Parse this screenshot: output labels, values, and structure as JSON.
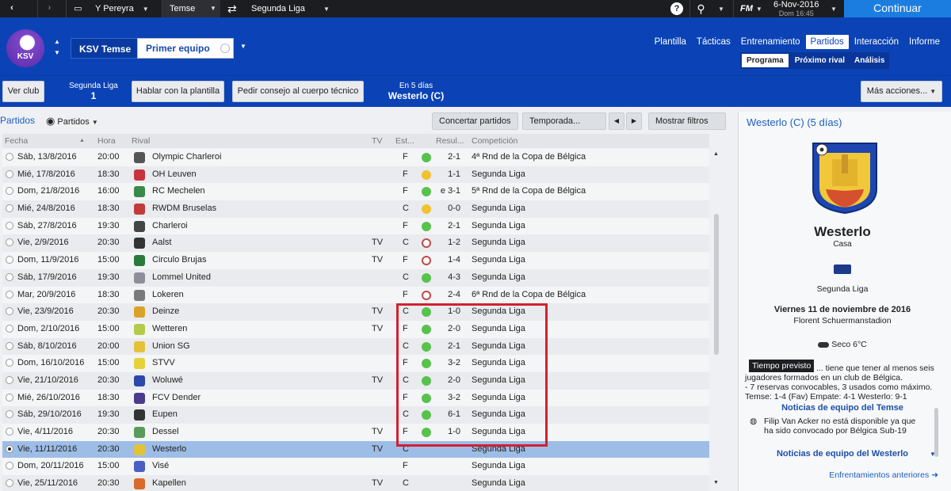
{
  "topbar": {
    "manager": "Y Pereyra",
    "club_tab": "Temse",
    "league": "Segunda Liga",
    "logo": "FM",
    "date": "6-Nov-2016",
    "day_time": "Dom 16:45",
    "continue": "Continuar",
    "icons": [
      "back-arrow",
      "forward-arrow",
      "bus-icon",
      "transfer-arrows-icon",
      "help-icon",
      "search-icon",
      "fm-logo"
    ]
  },
  "header": {
    "club_logo": "KSV",
    "team_name": "KSV Temse",
    "team_selector": "Primer equipo",
    "nav": [
      "Plantilla",
      "Tácticas",
      "Entrenamiento",
      "Partidos",
      "Interacción",
      "Informe"
    ],
    "nav_active": "Partidos",
    "subnav": [
      "Programa",
      "Próximo rival",
      "Análisis"
    ],
    "subnav_active": "Programa"
  },
  "actionbar": {
    "view_club": "Ver club",
    "league_label": "Segunda Liga",
    "league_pos": "1",
    "talk_squad": "Hablar con la plantilla",
    "ask_staff": "Pedir consejo al cuerpo técnico",
    "next_in": "En 5 días",
    "next_opp": "Westerlo (C)",
    "more_actions": "Más acciones..."
  },
  "listbar": {
    "crumb": "Partidos",
    "view": "Partidos",
    "arrange": "Concertar partidos",
    "season": "Temporada...",
    "filters": "Mostrar filtros"
  },
  "columns": {
    "date": "Fecha",
    "time": "Hora",
    "rival": "Rival",
    "tv": "TV",
    "status": "Est...",
    "result": "Resul...",
    "competition": "Competición"
  },
  "colors": {
    "win": "#57c24c",
    "draw": "#f1c130",
    "loss": "#c04a4a",
    "accent": "#0b43b6",
    "highlight": "#d42030"
  },
  "matches": [
    {
      "date": "Sáb, 13/8/2016",
      "time": "20:00",
      "rival": "Olympic Charleroi",
      "tv": "",
      "venue": "F",
      "outcome": "win",
      "result": "2-1",
      "competition": "4ª Rnd de la Copa de Bélgica",
      "crest": "#555555"
    },
    {
      "date": "Mié, 17/8/2016",
      "time": "18:30",
      "rival": "OH Leuven",
      "tv": "",
      "venue": "F",
      "outcome": "draw",
      "result": "1-1",
      "competition": "Segunda Liga",
      "crest": "#c7343c"
    },
    {
      "date": "Dom, 21/8/2016",
      "time": "16:00",
      "rival": "RC Mechelen",
      "tv": "",
      "venue": "F",
      "outcome": "win",
      "result": "e 3-1",
      "competition": "5ª Rnd de la Copa de Bélgica",
      "crest": "#3a8a4a"
    },
    {
      "date": "Mié, 24/8/2016",
      "time": "18:30",
      "rival": "RWDM Bruselas",
      "tv": "",
      "venue": "C",
      "outcome": "draw",
      "result": "0-0",
      "competition": "Segunda Liga",
      "crest": "#c23a3a"
    },
    {
      "date": "Sáb, 27/8/2016",
      "time": "19:30",
      "rival": "Charleroi",
      "tv": "",
      "venue": "F",
      "outcome": "win",
      "result": "2-1",
      "competition": "Segunda Liga",
      "crest": "#444444"
    },
    {
      "date": "Vie, 2/9/2016",
      "time": "20:30",
      "rival": "Aalst",
      "tv": "TV",
      "venue": "C",
      "outcome": "loss",
      "result": "1-2",
      "competition": "Segunda Liga",
      "crest": "#333333"
    },
    {
      "date": "Dom, 11/9/2016",
      "time": "15:00",
      "rival": "Circulo Brujas",
      "tv": "TV",
      "venue": "F",
      "outcome": "loss",
      "result": "1-4",
      "competition": "Segunda Liga",
      "crest": "#2b7a3b"
    },
    {
      "date": "Sáb, 17/9/2016",
      "time": "19:30",
      "rival": "Lommel United",
      "tv": "",
      "venue": "C",
      "outcome": "win",
      "result": "4-3",
      "competition": "Segunda Liga",
      "crest": "#8e8e9a"
    },
    {
      "date": "Mar, 20/9/2016",
      "time": "18:30",
      "rival": "Lokeren",
      "tv": "",
      "venue": "F",
      "outcome": "loss",
      "result": "2-4",
      "competition": "6ª Rnd de la Copa de Bélgica",
      "crest": "#7a7a7a"
    },
    {
      "date": "Vie, 23/9/2016",
      "time": "20:30",
      "rival": "Deinze",
      "tv": "TV",
      "venue": "C",
      "outcome": "win",
      "result": "1-0",
      "competition": "Segunda Liga",
      "crest": "#d9a32a"
    },
    {
      "date": "Dom, 2/10/2016",
      "time": "15:00",
      "rival": "Wetteren",
      "tv": "TV",
      "venue": "F",
      "outcome": "win",
      "result": "2-0",
      "competition": "Segunda Liga",
      "crest": "#b5c94a"
    },
    {
      "date": "Sáb, 8/10/2016",
      "time": "20:00",
      "rival": "Union SG",
      "tv": "",
      "venue": "C",
      "outcome": "win",
      "result": "2-1",
      "competition": "Segunda Liga",
      "crest": "#e3c23a"
    },
    {
      "date": "Dom, 16/10/2016",
      "time": "15:00",
      "rival": "STVV",
      "tv": "",
      "venue": "F",
      "outcome": "win",
      "result": "3-2",
      "competition": "Segunda Liga",
      "crest": "#e5d23a"
    },
    {
      "date": "Vie, 21/10/2016",
      "time": "20:30",
      "rival": "Woluwé",
      "tv": "TV",
      "venue": "C",
      "outcome": "win",
      "result": "2-0",
      "competition": "Segunda Liga",
      "crest": "#2a49a8"
    },
    {
      "date": "Mié, 26/10/2016",
      "time": "18:30",
      "rival": "FCV Dender",
      "tv": "",
      "venue": "F",
      "outcome": "win",
      "result": "3-2",
      "competition": "Segunda Liga",
      "crest": "#4b3b8a"
    },
    {
      "date": "Sáb, 29/10/2016",
      "time": "19:30",
      "rival": "Eupen",
      "tv": "",
      "venue": "C",
      "outcome": "win",
      "result": "6-1",
      "competition": "Segunda Liga",
      "crest": "#333333"
    },
    {
      "date": "Vie, 4/11/2016",
      "time": "20:30",
      "rival": "Dessel",
      "tv": "TV",
      "venue": "F",
      "outcome": "win",
      "result": "1-0",
      "competition": "Segunda Liga",
      "crest": "#5a9a5a"
    },
    {
      "date": "Vie, 11/11/2016",
      "time": "20:30",
      "rival": "Westerlo",
      "tv": "TV",
      "venue": "C",
      "outcome": "",
      "result": "",
      "competition": "Segunda Liga",
      "crest": "#e3c23a",
      "selected": true
    },
    {
      "date": "Dom, 20/11/2016",
      "time": "15:00",
      "rival": "Visé",
      "tv": "",
      "venue": "F",
      "outcome": "",
      "result": "",
      "competition": "Segunda Liga",
      "crest": "#4a5ec4"
    },
    {
      "date": "Vie, 25/11/2016",
      "time": "20:30",
      "rival": "Kapellen",
      "tv": "TV",
      "venue": "C",
      "outcome": "",
      "result": "",
      "competition": "Segunda Liga",
      "crest": "#d96a2a"
    }
  ],
  "panel": {
    "title": "Westerlo (C) (5 días)",
    "team": "Westerlo",
    "venue": "Casa",
    "competition": "Segunda Liga",
    "date": "Viernes 11 de noviembre de 2016",
    "stadium": "Florent Schuermanstadion",
    "weather": "Seco 6°C",
    "tooltip": "Tiempo previsto",
    "rule_line1": "... tiene que tener al menos seis",
    "rule_line2": "jugadores formados en un club de Bélgica.",
    "rule_line3": "- 7 reservas convocables, 3 usados como máximo.",
    "odds": "Temse: 1-4 (Fav)  Empate: 4-1  Westerlo: 9-1",
    "news_temse_title": "Noticias de equipo del Temse",
    "news_temse_line1": "Filip Van Acker no está disponible ya que",
    "news_temse_line2": "ha sido convocado por Bélgica Sub-19",
    "news_westerlo_title": "Noticias de equipo del Westerlo",
    "previous": "Enfrentamientos anteriores"
  }
}
